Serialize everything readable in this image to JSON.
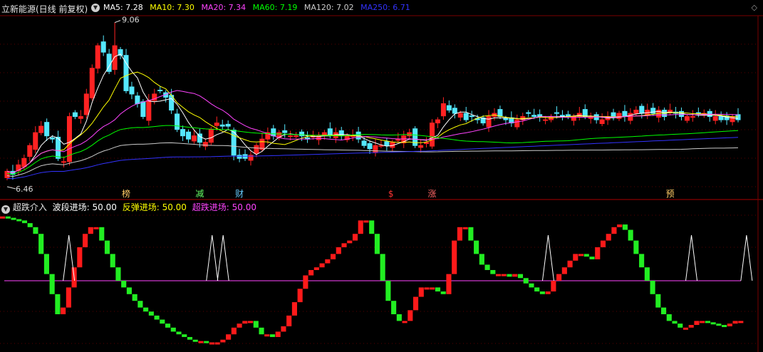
{
  "header": {
    "title": "立新能源(日线 前复权)",
    "ma": [
      {
        "label": "MA5: 7.28",
        "color": "#ffffff"
      },
      {
        "label": "MA10: 7.30",
        "color": "#ffff00"
      },
      {
        "label": "MA20: 7.34",
        "color": "#ff44ff"
      },
      {
        "label": "MA60: 7.19",
        "color": "#00ff00"
      },
      {
        "label": "MA120: 7.02",
        "color": "#cccccc"
      },
      {
        "label": "MA250: 6.71",
        "color": "#3333ff"
      }
    ],
    "nav_arrows": "◇"
  },
  "lower": {
    "title": "超跌介入",
    "items": [
      {
        "label": "波段进场: 50.00",
        "color": "#ffffff"
      },
      {
        "label": "反弹进场: 50.00",
        "color": "#ffff00"
      },
      {
        "label": "超跌进场: 50.00",
        "color": "#ff44ff"
      }
    ]
  },
  "chart_data": [
    {
      "type": "candlestick",
      "title": "立新能源(日线 前复权)",
      "annotations": [
        {
          "label": "9.06",
          "index": 19
        },
        {
          "label": "6.46",
          "index": 0
        }
      ],
      "markers": [
        {
          "label": "榜",
          "index": 21,
          "color": "#ffcc66"
        },
        {
          "label": "减",
          "index": 34,
          "color": "#66ff66"
        },
        {
          "label": "财",
          "index": 41,
          "color": "#66ccff"
        },
        {
          "label": "$",
          "index": 68,
          "color": "#ff3333"
        },
        {
          "label": "涨",
          "index": 75,
          "color": "#ff6666"
        },
        {
          "label": "预",
          "index": 117,
          "color": "#ffcc66"
        }
      ],
      "ylim": [
        6.4,
        9.1
      ],
      "series_close": [
        6.75,
        6.7,
        6.85,
        6.95,
        7.15,
        7.35,
        7.45,
        7.3,
        7.25,
        6.95,
        6.9,
        7.6,
        7.6,
        7.6,
        7.95,
        8.35,
        8.7,
        8.6,
        8.3,
        8.7,
        8.55,
        8.0,
        7.95,
        7.8,
        7.6,
        7.85,
        7.95,
        8.0,
        7.9,
        7.7,
        7.4,
        7.3,
        7.25,
        7.3,
        7.2,
        7.2,
        7.4,
        7.5,
        7.45,
        7.45,
        7.0,
        6.95,
        6.95,
        7.0,
        7.15,
        7.25,
        7.35,
        7.3,
        7.35,
        7.35,
        7.3,
        7.3,
        7.3,
        7.25,
        7.3,
        7.3,
        7.35,
        7.3,
        7.35,
        7.3,
        7.3,
        7.3,
        7.25,
        7.15,
        7.1,
        7.15,
        7.15,
        7.15,
        7.2,
        7.25,
        7.3,
        7.35,
        7.15,
        7.15,
        7.2,
        7.5,
        7.55,
        7.8,
        7.7,
        7.65,
        7.65,
        7.55,
        7.6,
        7.55,
        7.5,
        7.6,
        7.65,
        7.6,
        7.55,
        7.5,
        7.55,
        7.6,
        7.65,
        7.6,
        7.6,
        7.55,
        7.6,
        7.65,
        7.6,
        7.6,
        7.6,
        7.65,
        7.6,
        7.6,
        7.55,
        7.55,
        7.6,
        7.6,
        7.65,
        7.6,
        7.65,
        7.7,
        7.65,
        7.7,
        7.65,
        7.7,
        7.6,
        7.7,
        7.65,
        7.6,
        7.6,
        7.6,
        7.65,
        7.65,
        7.6,
        7.6,
        7.55,
        7.55,
        7.6,
        7.55
      ],
      "ma_series": [
        {
          "name": "MA5",
          "color": "#ffffff"
        },
        {
          "name": "MA10",
          "color": "#ffff00"
        },
        {
          "name": "MA20",
          "color": "#ff44ff"
        },
        {
          "name": "MA60",
          "color": "#00ff00"
        },
        {
          "name": "MA120",
          "color": "#cccccc"
        },
        {
          "name": "MA250",
          "color": "#3333ff"
        }
      ]
    },
    {
      "type": "bar",
      "title": "超跌介入",
      "ylim": [
        0,
        100
      ],
      "reference_line": 50,
      "values": [
        98,
        97,
        96,
        95,
        93,
        90,
        85,
        70,
        55,
        40,
        25,
        30,
        45,
        60,
        75,
        85,
        90,
        90,
        80,
        70,
        60,
        50,
        45,
        40,
        35,
        30,
        27,
        24,
        21,
        18,
        15,
        12,
        10,
        8,
        6,
        5,
        5,
        4,
        4,
        4,
        6,
        10,
        15,
        18,
        20,
        20,
        15,
        10,
        10,
        8,
        12,
        16,
        24,
        34,
        44,
        54,
        58,
        60,
        63,
        66,
        70,
        75,
        78,
        80,
        85,
        95,
        95,
        85,
        70,
        50,
        35,
        25,
        20,
        20,
        28,
        38,
        45,
        45,
        45,
        42,
        40,
        55,
        80,
        90,
        90,
        80,
        70,
        62,
        58,
        55,
        55,
        55,
        53,
        55,
        52,
        48,
        45,
        42,
        40,
        42,
        50,
        55,
        60,
        65,
        70,
        70,
        68,
        66,
        75,
        80,
        85,
        90,
        92,
        88,
        80,
        70,
        60,
        50,
        40,
        30,
        25,
        20,
        18,
        15,
        15,
        17,
        20,
        20,
        19,
        18,
        17,
        16,
        18,
        20,
        20
      ]
    }
  ]
}
